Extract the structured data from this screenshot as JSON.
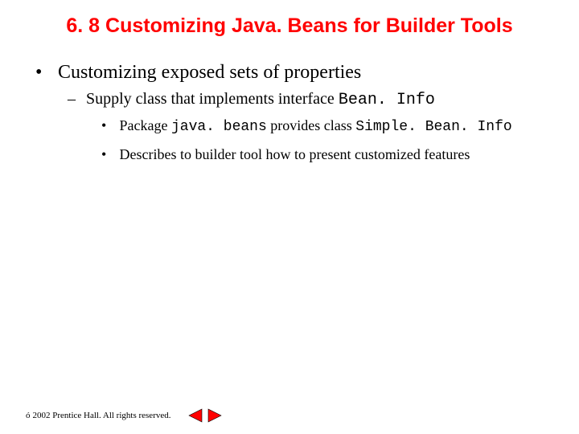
{
  "title": "6. 8   Customizing Java. Beans for Builder Tools",
  "bullets": {
    "l1": "Customizing exposed sets of properties",
    "l2_pre": "Supply class that implements interface ",
    "l2_code": "Bean. Info",
    "l3a_pre": "Package ",
    "l3a_code1": "java. beans",
    "l3a_mid": " provides class ",
    "l3a_code2": "Simple. Bean. Info",
    "l3b": "Describes to builder tool how to present customized features"
  },
  "footer": {
    "symbol": "ó",
    "text": " 2002 Prentice Hall. All rights reserved."
  },
  "icons": {
    "prev": "nav-prev-icon",
    "next": "nav-next-icon"
  }
}
